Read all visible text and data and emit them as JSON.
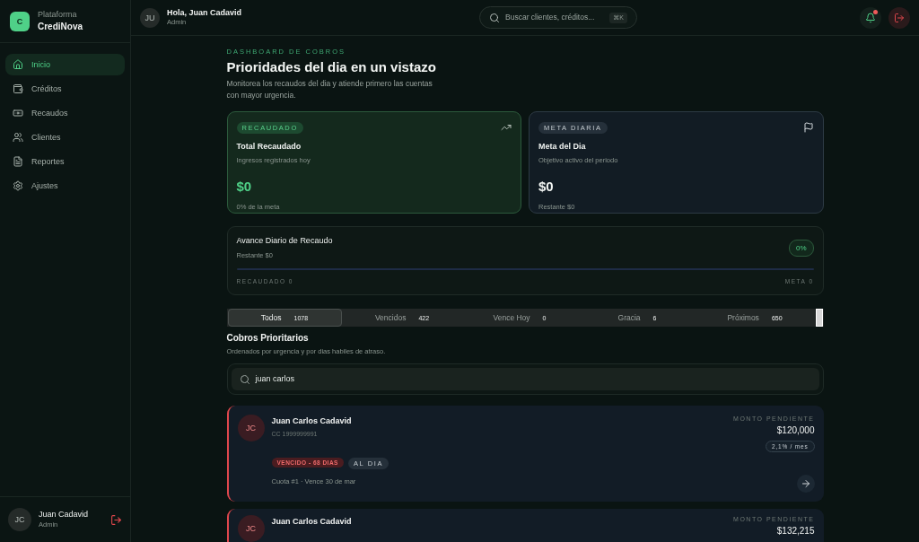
{
  "brand": {
    "logo": "C",
    "label": "Plataforma",
    "name": "CrediNova"
  },
  "nav": [
    {
      "label": "Inicio",
      "selected": true
    },
    {
      "label": "Créditos",
      "selected": false
    },
    {
      "label": "Recaudos",
      "selected": false
    },
    {
      "label": "Clientes",
      "selected": false
    },
    {
      "label": "Reportes",
      "selected": false
    },
    {
      "label": "Ajustes",
      "selected": false
    }
  ],
  "sidebar_user": {
    "initials": "JC",
    "name": "Juan Cadavid",
    "role": "Admin"
  },
  "header": {
    "initials": "JU",
    "greeting": "Hola, Juan Cadavid",
    "role": "Admin",
    "search_placeholder": "Buscar clientes, créditos...",
    "shortcut": "⌘K",
    "notification": true
  },
  "page": {
    "eyebrow": "DASHBOARD DE COBROS",
    "title": "Prioridades del dia en un vistazo",
    "subtitle": "Monitorea los recaudos del dia y atiende primero las cuentas con mayor urgencia."
  },
  "stats": [
    {
      "kind": "green",
      "badge": "RECAUDADO",
      "title": "Total Recaudado",
      "subtitle": "Ingresos registrados hoy",
      "value": "$0",
      "note": "0% de la meta"
    },
    {
      "kind": "neutral",
      "badge": "META DIARIA",
      "title": "Meta del Dia",
      "subtitle": "Objetivo activo del periodo",
      "value": "$0",
      "note": "Restante $0"
    }
  ],
  "progress": {
    "title": "Avance Diario de Recaudo",
    "subtitle": "Restante $0",
    "percent": "0%",
    "left_label": "RECAUDADO 0",
    "right_label": "META 0"
  },
  "filters": [
    {
      "label": "Todos",
      "count": "1078",
      "selected": true
    },
    {
      "label": "Vencidos",
      "count": "422",
      "selected": false
    },
    {
      "label": "Vence Hoy",
      "count": "0",
      "selected": false
    },
    {
      "label": "Gracia",
      "count": "6",
      "selected": false
    },
    {
      "label": "Próximos",
      "count": "650",
      "selected": false
    }
  ],
  "list": {
    "title": "Cobros Prioritarios",
    "subtitle": "Ordenados por urgencia y por dias habiles de atraso.",
    "search_value": "juan carlos"
  },
  "cobros": [
    {
      "initials": "JC",
      "name": "Juan Carlos Cadavid",
      "doc": "CC 1999999991",
      "amount_label": "MONTO PENDIENTE",
      "amount": "$120,000",
      "rate": "2,1% / mes",
      "tags": [
        {
          "kind": "danger",
          "label": "VENCIDO - 68 DIAS"
        },
        {
          "kind": "neutral",
          "label": "AL DIA"
        }
      ],
      "detail": "Cuota #1 · Vence 30 de mar"
    },
    {
      "initials": "JC",
      "name": "Juan Carlos Cadavid",
      "amount_label": "MONTO PENDIENTE",
      "amount": "$132,215"
    }
  ]
}
